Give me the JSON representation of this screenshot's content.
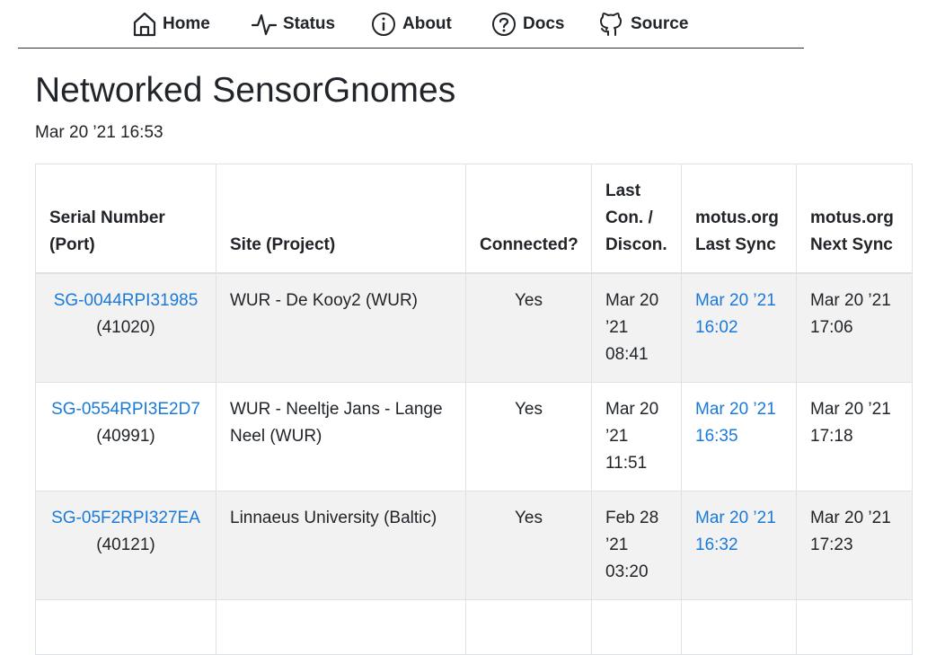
{
  "nav": [
    {
      "label": "Home",
      "icon": "home-icon"
    },
    {
      "label": "Status",
      "icon": "pulse-icon"
    },
    {
      "label": "About",
      "icon": "info-icon"
    },
    {
      "label": "Docs",
      "icon": "question-icon"
    },
    {
      "label": "Source",
      "icon": "github-icon"
    }
  ],
  "page": {
    "title": "Networked SensorGnomes",
    "timestamp": "Mar 20 ’21 16:53"
  },
  "table": {
    "headers": {
      "serial": "Serial Number (Port)",
      "site": "Site (Project)",
      "connected": "Connected?",
      "lastcon": "Last Con. / Discon.",
      "lastsync": "motus.org Last Sync",
      "nextsync": "motus.org Next Sync"
    },
    "rows": [
      {
        "serial": "SG-0044RPI31985",
        "port": "(41020)",
        "site": "WUR - De Kooy2 (WUR)",
        "connected": "Yes",
        "lastcon": "Mar 20 ’21 08:41",
        "lastsync": "Mar 20 ’21 16:02",
        "nextsync": "Mar 20 ’21 17:06"
      },
      {
        "serial": "SG-0554RPI3E2D7",
        "port": "(40991)",
        "site": "WUR - Neeltje Jans - Lange Neel (WUR)",
        "connected": "Yes",
        "lastcon": "Mar 20 ’21 11:51",
        "lastsync": "Mar 20 ’21 16:35",
        "nextsync": "Mar 20 ’21 17:18"
      },
      {
        "serial": "SG-05F2RPI327EA",
        "port": "(40121)",
        "site": "Linnaeus University (Baltic)",
        "connected": "Yes",
        "lastcon": "Feb 28 ’21 03:20",
        "lastsync": "Mar 20 ’21 16:32",
        "nextsync": "Mar 20 ’21 17:23"
      },
      {
        "serial": "",
        "port": "",
        "site": "",
        "connected": "",
        "lastcon": "",
        "lastsync": "",
        "nextsync": ""
      }
    ]
  },
  "colors": {
    "link": "#1a7ad9",
    "stripe": "#f2f2f2",
    "border": "#dee2e6"
  }
}
